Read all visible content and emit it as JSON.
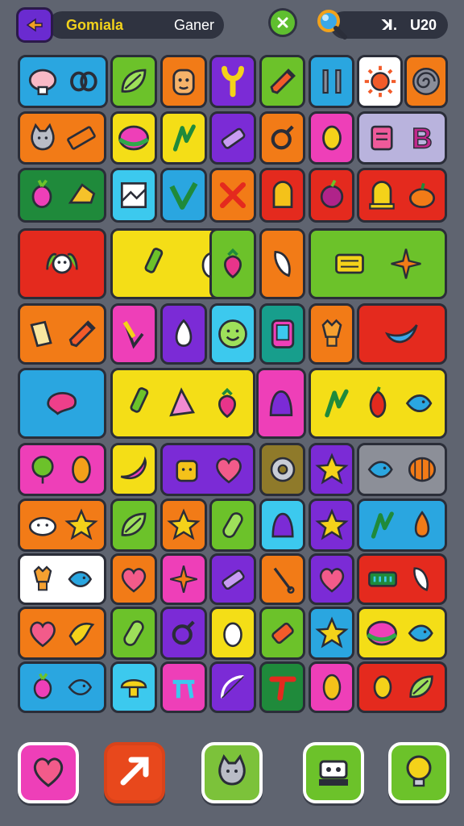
{
  "header": {
    "app_title": "Gomiala",
    "mode_label": "Ganer",
    "score_prefix": "ꓘ.",
    "score_value": "U20",
    "icons": {
      "back": "back-arrow-icon",
      "close": "close-icon",
      "search": "magnifier-icon"
    }
  },
  "palette": {
    "blue": "#2aa6e0",
    "green": "#6cc22a",
    "orange": "#f27b17",
    "purple": "#7b2bd6",
    "yellow": "#f4de17",
    "pink": "#ee3fb8",
    "red": "#e42a1e",
    "darkgreen": "#1f8a3b",
    "cyan": "#3cc9ee",
    "gray": "#8c8f98",
    "white": "#ffffff",
    "lavender": "#b9b3dd",
    "olive": "#8f7a2a",
    "teal": "#179e8c"
  },
  "tiles": [
    {
      "color": "blue",
      "icons": [
        "brain-icon",
        "bean-icon"
      ]
    },
    {
      "color": "green",
      "icons": [
        "leaf-icon"
      ]
    },
    {
      "color": "orange",
      "icons": [
        "face-icon"
      ]
    },
    {
      "color": "purple",
      "icons": [
        "plant-icon"
      ]
    },
    {
      "color": "green",
      "icons": [
        "pencil-icon"
      ]
    },
    {
      "color": "blue",
      "icons": [
        "bars-icon"
      ]
    },
    {
      "color": "white",
      "icons": [
        "sun-icon"
      ]
    },
    {
      "color": "orange",
      "icons": [
        "spiral-icon"
      ]
    },
    {
      "color": "orange",
      "icons": [
        "cat-icon",
        "ruler-icon"
      ]
    },
    {
      "color": "yellow",
      "icons": [
        "watermelon-icon"
      ]
    },
    {
      "color": "yellow",
      "icons": [
        "sprout-icon"
      ]
    },
    {
      "color": "purple",
      "icons": [
        "crayon-icon"
      ]
    },
    {
      "color": "orange",
      "icons": [
        "ring-icon"
      ]
    },
    {
      "color": "pink",
      "icons": [
        "lemon-icon"
      ]
    },
    {
      "color": "lavender",
      "icons": [
        "notebook-icon",
        "letter-b-icon"
      ]
    },
    {
      "color": "darkgreen",
      "icons": [
        "radish-icon",
        "cheese-icon"
      ]
    },
    {
      "color": "cyan",
      "icons": [
        "picture-icon"
      ]
    },
    {
      "color": "blue",
      "icons": [
        "check-icon"
      ]
    },
    {
      "color": "orange",
      "icons": [
        "cross-icon"
      ]
    },
    {
      "color": "red",
      "icons": [
        "tomb-icon"
      ]
    },
    {
      "color": "red",
      "icons": [
        "plum-icon"
      ]
    },
    {
      "color": "red",
      "icons": [
        "tombstone-icon",
        "pumpkin-icon"
      ]
    },
    {
      "color": "red",
      "icons": [
        "ghost-icon"
      ]
    },
    {
      "color": "yellow",
      "icons": [
        "pen-icon",
        "egg-icon"
      ]
    },
    {
      "color": "green",
      "icons": [
        "strawberry-icon"
      ]
    },
    {
      "color": "orange",
      "icons": [
        "feather-icon"
      ]
    },
    {
      "color": "green",
      "icons": [
        "scroll-icon",
        "sparkle-icon"
      ]
    },
    {
      "color": "orange",
      "icons": [
        "book-icon",
        "pencil-icon"
      ]
    },
    {
      "color": "pink",
      "icons": [
        "compass-icon"
      ]
    },
    {
      "color": "purple",
      "icons": [
        "garlic-icon"
      ]
    },
    {
      "color": "cyan",
      "icons": [
        "smiley-icon"
      ]
    },
    {
      "color": "teal",
      "icons": [
        "tablet-icon"
      ]
    },
    {
      "color": "orange",
      "icons": [
        "lamp-icon"
      ]
    },
    {
      "color": "red",
      "icons": [
        "banana-icon"
      ]
    },
    {
      "color": "blue",
      "icons": [
        "blob-icon"
      ]
    },
    {
      "color": "yellow",
      "icons": [
        "pen-icon",
        "tent-icon",
        "strawberry-icon"
      ]
    },
    {
      "color": "pink",
      "icons": [
        "bell-icon"
      ]
    },
    {
      "color": "yellow",
      "icons": [
        "sprout-icon",
        "pepper-icon",
        "fish-icon"
      ]
    },
    {
      "color": "pink",
      "icons": [
        "balloon-icon",
        "seed-icon"
      ]
    },
    {
      "color": "yellow",
      "icons": [
        "chili-icon"
      ]
    },
    {
      "color": "purple",
      "icons": [
        "pot-icon",
        "heart-icon"
      ]
    },
    {
      "color": "olive",
      "icons": [
        "donut-icon"
      ]
    },
    {
      "color": "purple",
      "icons": [
        "star-icon"
      ]
    },
    {
      "color": "gray",
      "icons": [
        "fish-icon",
        "shell-icon"
      ]
    },
    {
      "color": "orange",
      "icons": [
        "cow-icon",
        "star-icon"
      ]
    },
    {
      "color": "green",
      "icons": [
        "leaf-icon"
      ]
    },
    {
      "color": "orange",
      "icons": [
        "star-icon"
      ]
    },
    {
      "color": "green",
      "icons": [
        "cucumber-icon"
      ]
    },
    {
      "color": "cyan",
      "icons": [
        "bell-icon"
      ]
    },
    {
      "color": "purple",
      "icons": [
        "star-icon"
      ]
    },
    {
      "color": "blue",
      "icons": [
        "sprout-icon",
        "drop-icon"
      ]
    },
    {
      "color": "white",
      "icons": [
        "lamp-icon",
        "fish-icon"
      ]
    },
    {
      "color": "orange",
      "icons": [
        "heart-icon"
      ]
    },
    {
      "color": "pink",
      "icons": [
        "sparkle-icon"
      ]
    },
    {
      "color": "purple",
      "icons": [
        "crayon-icon"
      ]
    },
    {
      "color": "orange",
      "icons": [
        "safety-pin-icon"
      ]
    },
    {
      "color": "purple",
      "icons": [
        "heart-icon"
      ]
    },
    {
      "color": "red",
      "icons": [
        "label-icon",
        "feather-icon"
      ]
    },
    {
      "color": "orange",
      "icons": [
        "heart-icon",
        "bird-icon"
      ]
    },
    {
      "color": "green",
      "icons": [
        "cucumber-icon"
      ]
    },
    {
      "color": "purple",
      "icons": [
        "ring-icon"
      ]
    },
    {
      "color": "yellow",
      "icons": [
        "egg-icon"
      ]
    },
    {
      "color": "green",
      "icons": [
        "tube-icon"
      ]
    },
    {
      "color": "blue",
      "icons": [
        "star-icon"
      ]
    },
    {
      "color": "yellow",
      "icons": [
        "watermelon-icon",
        "fish-icon"
      ]
    },
    {
      "color": "blue",
      "icons": [
        "radish-icon",
        "fish-icon"
      ]
    },
    {
      "color": "cyan",
      "icons": [
        "mushroom-icon"
      ]
    },
    {
      "color": "pink",
      "icons": [
        "gate-icon"
      ]
    },
    {
      "color": "purple",
      "icons": [
        "bow-icon"
      ]
    },
    {
      "color": "darkgreen",
      "icons": [
        "letter-t-icon"
      ]
    },
    {
      "color": "pink",
      "icons": [
        "peanut-icon"
      ]
    },
    {
      "color": "red",
      "icons": [
        "lemon-icon",
        "leaf-icon"
      ]
    }
  ],
  "bottom_bar": [
    {
      "name": "favorites-button",
      "icon": "heart-icon",
      "color": "#ee3fb8"
    },
    {
      "name": "send-button",
      "icon": "arrow-icon",
      "color": "#e8481c"
    },
    {
      "name": "pet-button",
      "icon": "cat-icon",
      "color": "#7cc23a"
    },
    {
      "name": "machine-button",
      "icon": "robot-icon",
      "color": "#6cc22a"
    },
    {
      "name": "hint-button",
      "icon": "bulb-icon",
      "color": "#6cc22a"
    }
  ]
}
